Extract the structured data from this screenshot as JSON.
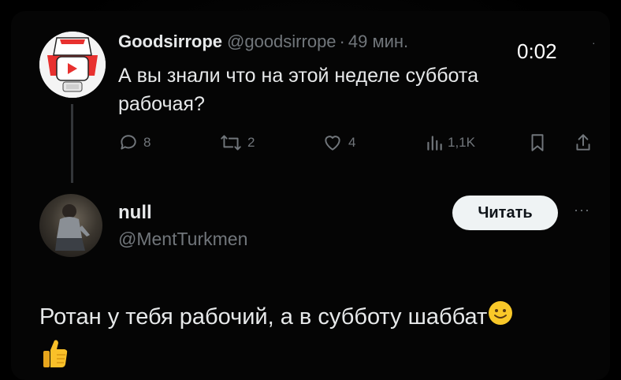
{
  "tweet": {
    "author_name": "Goodsirrope",
    "author_handle": "@goodsirrope",
    "separator": "·",
    "time_ago": "49 мин.",
    "text": "А вы знали что на этой неделе суббота рабочая?",
    "video_time": "0:02",
    "replies": "8",
    "retweets": "2",
    "likes": "4",
    "views": "1,1K"
  },
  "reply": {
    "author_name": "null",
    "author_handle": "@MentTurkmen",
    "follow_label": "Читать",
    "more_label": "···",
    "text": "Ротан у тебя рабочий, а в субботу шаббат"
  },
  "icons": {
    "reply": "reply-icon",
    "retweet": "retweet-icon",
    "like": "heart-icon",
    "views": "views-icon",
    "bookmark": "bookmark-icon",
    "share": "share-icon",
    "smile": "slightly-smiling-face-emoji",
    "thumbs": "thumbs-up-emoji"
  },
  "colors": {
    "background": "#000000",
    "text_primary": "#e7e9ea",
    "text_secondary": "#71767b",
    "button_bg": "#eff3f4",
    "button_text": "#0f1419",
    "avatar_brand_red": "#e8312f"
  }
}
